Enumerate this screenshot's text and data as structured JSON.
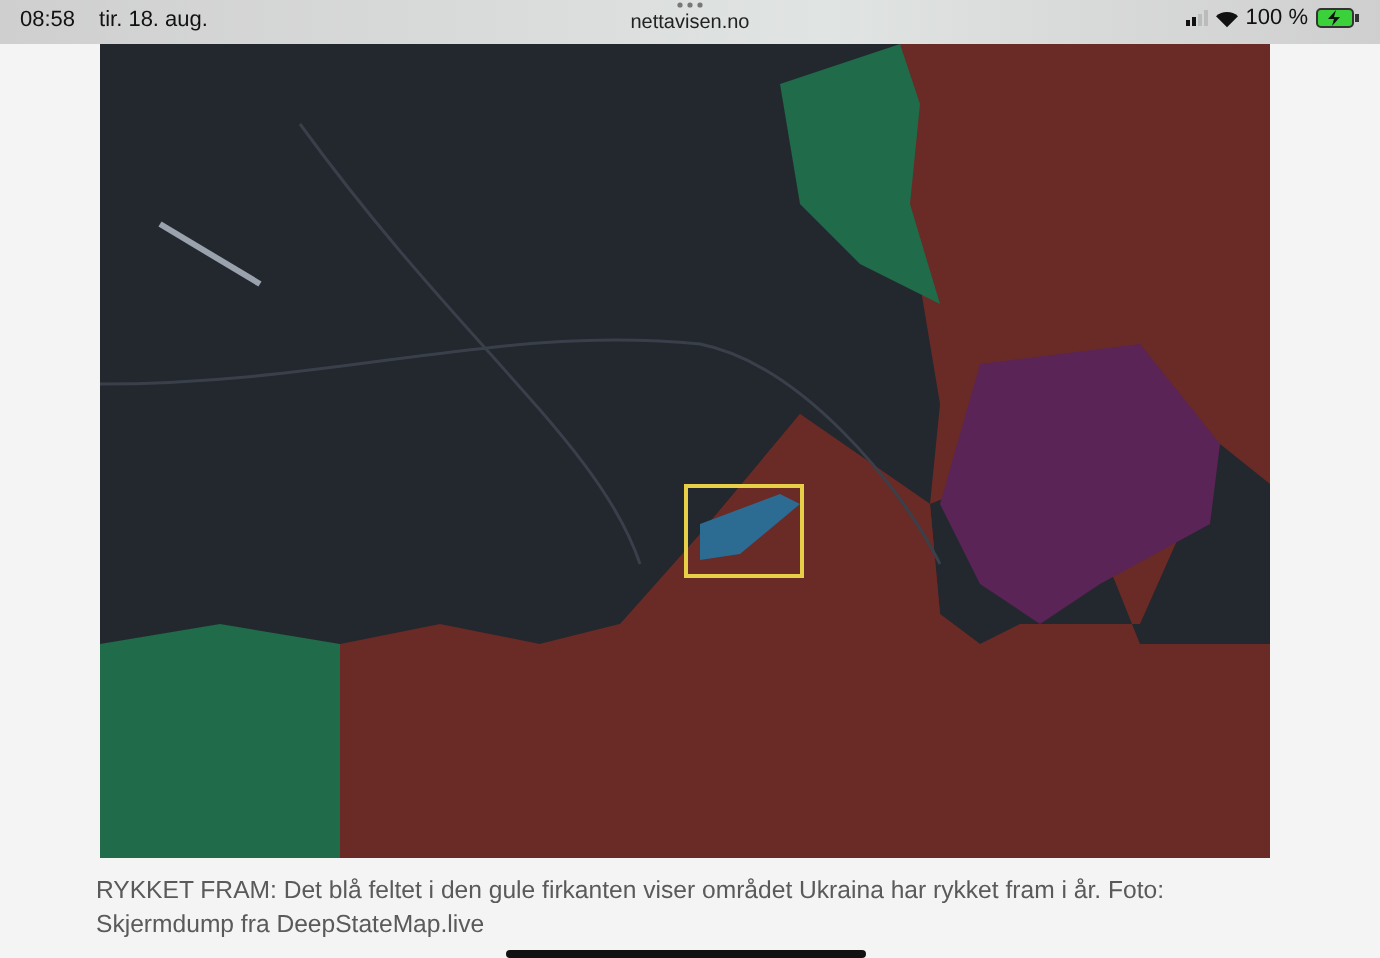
{
  "status_bar": {
    "time": "08:58",
    "date": "tir. 18. aug.",
    "battery": "100 %"
  },
  "address_bar": {
    "url": "nettavisen.no"
  },
  "article": {
    "caption": "RYKKET FRAM: Det blå feltet i den gule firkanten viser området Ukraina har rykket fram i år. Foto: Skjermdump fra DeepStateMap.live"
  }
}
